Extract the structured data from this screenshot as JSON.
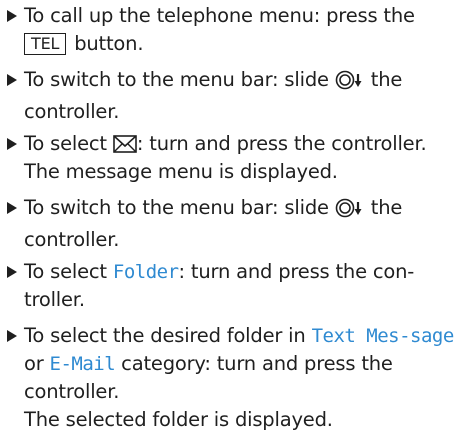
{
  "steps": [
    {
      "pre": "To call up the telephone menu: press the",
      "key": "TEL",
      "post": " button."
    },
    {
      "pre": "To switch to the menu bar: slide ",
      "post": " the controller."
    },
    {
      "pre": "To select ",
      "post": ": turn and press the controller."
    },
    {
      "pre": "To switch to the menu bar: slide ",
      "post": " the controller."
    },
    {
      "pre": "To select ",
      "hl": "Folder",
      "post": ": turn and press the con-troller."
    },
    {
      "pre": "To select the desired folder in ",
      "hl1": "Text Mes-sage",
      "mid": " or ",
      "hl2": "E-Mail",
      "post": " category: turn and press the controller."
    }
  ],
  "results": {
    "message_menu": "The message menu is displayed.",
    "folder_displayed": "The selected folder is displayed."
  },
  "icons": {
    "bullet": "triangle-bullet-icon",
    "slide_down": "controller-slide-down-icon",
    "message": "envelope-icon"
  },
  "colors": {
    "text": "#1f1f1f",
    "highlight": "#2f8ad1"
  }
}
